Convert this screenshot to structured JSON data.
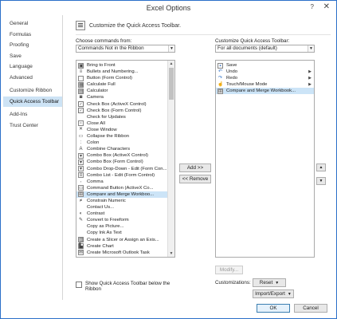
{
  "window": {
    "title": "Excel Options",
    "help": "?",
    "close": "✕"
  },
  "sidebar": {
    "items": [
      {
        "label": "General"
      },
      {
        "label": "Formulas"
      },
      {
        "label": "Proofing"
      },
      {
        "label": "Save"
      },
      {
        "label": "Language"
      },
      {
        "label": "Advanced"
      },
      {
        "label": "Customize Ribbon"
      },
      {
        "label": "Quick Access Toolbar",
        "active": true
      },
      {
        "label": "Add-Ins"
      },
      {
        "label": "Trust Center"
      }
    ]
  },
  "main": {
    "heading": "Customize the Quick Access Toolbar.",
    "choose_label": "Choose commands from:",
    "choose_value": "Commands Not in the Ribbon",
    "customize_label": "Customize Quick Access Toolbar:",
    "customize_value": "For all documents (default)",
    "commands": [
      {
        "label": "Bring to Front",
        "icon": "bring-to-front-icon"
      },
      {
        "label": "Bullets and Numbering...",
        "icon": "bullets-icon"
      },
      {
        "label": "Button (Form Control)",
        "icon": "button-icon"
      },
      {
        "label": "Calculate Full",
        "icon": "calculate-icon"
      },
      {
        "label": "Calculator",
        "icon": "calculator-icon"
      },
      {
        "label": "Camera",
        "icon": "camera-icon"
      },
      {
        "label": "Check Box (ActiveX Control)",
        "icon": "checkbox-icon"
      },
      {
        "label": "Check Box (Form Control)",
        "icon": "checkbox-icon"
      },
      {
        "label": "Check for Updates",
        "icon": ""
      },
      {
        "label": "Close All",
        "icon": "close-all-icon"
      },
      {
        "label": "Close Window",
        "icon": "close-window-icon"
      },
      {
        "label": "Collapse the Ribbon",
        "icon": "collapse-icon"
      },
      {
        "label": "Colon",
        "icon": "colon-icon"
      },
      {
        "label": "Combine Characters",
        "icon": "combine-icon"
      },
      {
        "label": "Combo Box (ActiveX Control)",
        "icon": "combo-box-icon"
      },
      {
        "label": "Combo Box (Form Control)",
        "icon": "combo-box-icon"
      },
      {
        "label": "Combo Drop-Down - Edit (Form Con...",
        "icon": "combo-dropdown-icon"
      },
      {
        "label": "Combo List - Edit (Form Control)",
        "icon": "combo-list-icon"
      },
      {
        "label": "Comma",
        "icon": "comma-icon"
      },
      {
        "label": "Command Button (ActiveX Co...",
        "icon": "command-button-icon"
      },
      {
        "label": "Compare and Merge Workboo...",
        "icon": "compare-merge-icon",
        "selected": true
      },
      {
        "label": "Constrain Numeric",
        "icon": "constrain-icon"
      },
      {
        "label": "Contact Us...",
        "icon": ""
      },
      {
        "label": "Contrast",
        "icon": "contrast-icon",
        "submenu": true
      },
      {
        "label": "Convert to Freeform",
        "icon": "freeform-icon"
      },
      {
        "label": "Copy as Picture...",
        "icon": ""
      },
      {
        "label": "Copy Ink As Text",
        "icon": ""
      },
      {
        "label": "Create a Slicer or Assign an Exis...",
        "icon": "slicer-icon"
      },
      {
        "label": "Create Chart",
        "icon": "chart-icon"
      },
      {
        "label": "Create Microsoft Outlook Task",
        "icon": "outlook-icon"
      }
    ],
    "toolbar_items": [
      {
        "label": "Save",
        "icon": "save-icon"
      },
      {
        "label": "Undo",
        "icon": "undo-icon",
        "submenu": true
      },
      {
        "label": "Redo",
        "icon": "redo-icon",
        "submenu": true
      },
      {
        "label": "Touch/Mouse Mode",
        "icon": "touch-icon",
        "submenu": true
      },
      {
        "label": "Compare and Merge Workbook...",
        "icon": "compare-merge-icon",
        "selected": true
      }
    ],
    "add_button": "Add >>",
    "remove_button": "<< Remove",
    "modify_button": "Modify...",
    "customizations_label": "Customizations:",
    "reset_button": "Reset",
    "import_export_button": "Import/Export",
    "show_below_label": "Show Quick Access Toolbar below the Ribbon",
    "show_below_checked": false,
    "ok_button": "OK",
    "cancel_button": "Cancel"
  }
}
